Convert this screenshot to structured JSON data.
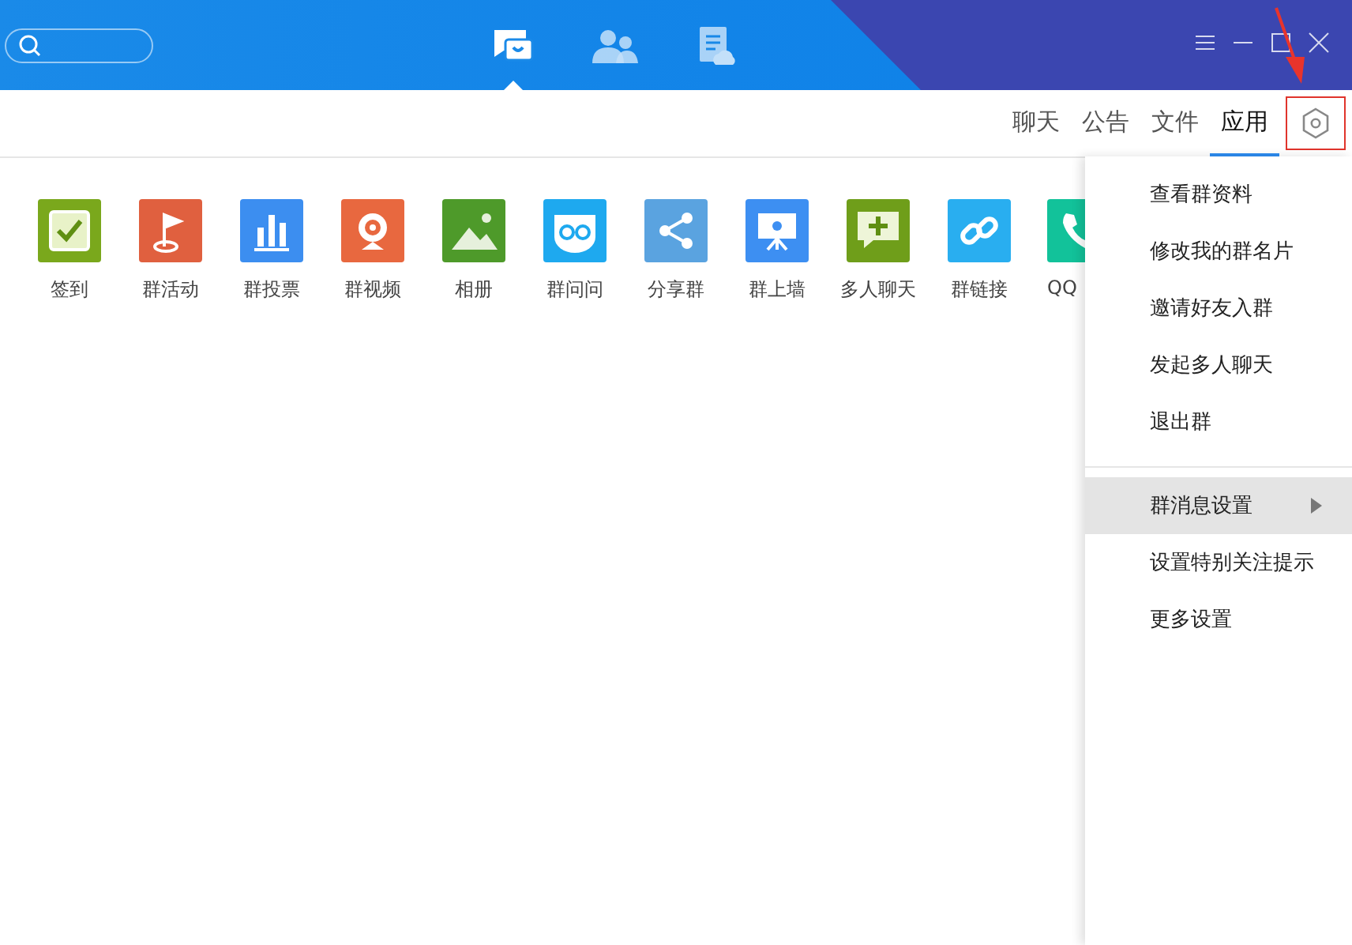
{
  "nav": [
    {
      "kind": "chat",
      "selected": true
    },
    {
      "kind": "contacts",
      "selected": false
    },
    {
      "kind": "docs",
      "selected": false
    }
  ],
  "tabs": [
    {
      "label": "聊天",
      "selected": false
    },
    {
      "label": "公告",
      "selected": false
    },
    {
      "label": "文件",
      "selected": false
    },
    {
      "label": "应用",
      "selected": true
    }
  ],
  "apps": [
    {
      "label": "签到",
      "kind": "check",
      "color": "#7aa81c"
    },
    {
      "label": "群活动",
      "kind": "flag",
      "color": "#e0603f"
    },
    {
      "label": "群投票",
      "kind": "bars",
      "color": "#3c8ef0"
    },
    {
      "label": "群视频",
      "kind": "camera",
      "color": "#e8683f"
    },
    {
      "label": "相册",
      "kind": "mountain",
      "color": "#4e9a2a"
    },
    {
      "label": "群问问",
      "kind": "owl",
      "color": "#1ea9ef"
    },
    {
      "label": "分享群",
      "kind": "share",
      "color": "#5aa3e0"
    },
    {
      "label": "群上墙",
      "kind": "board",
      "color": "#3d8ff2"
    },
    {
      "label": "多人聊天",
      "kind": "plus",
      "color": "#6f9e1a"
    },
    {
      "label": "群链接",
      "kind": "link",
      "color": "#29aef0"
    },
    {
      "label": "QQ",
      "kind": "phone",
      "color": "#12c29a",
      "cut": true
    }
  ],
  "menu": {
    "groups": [
      [
        {
          "label": "查看群资料",
          "kind": "item",
          "selected": false
        },
        {
          "label": "修改我的群名片",
          "kind": "item",
          "selected": false
        },
        {
          "label": "邀请好友入群",
          "kind": "item",
          "selected": false
        },
        {
          "label": "发起多人聊天",
          "kind": "item",
          "selected": false
        },
        {
          "label": "退出群",
          "kind": "item",
          "selected": false
        }
      ],
      [
        {
          "label": "群消息设置",
          "kind": "submenu",
          "selected": true
        },
        {
          "label": "设置特别关注提示",
          "kind": "item",
          "selected": false
        },
        {
          "label": "更多设置",
          "kind": "item",
          "selected": false
        }
      ]
    ]
  }
}
